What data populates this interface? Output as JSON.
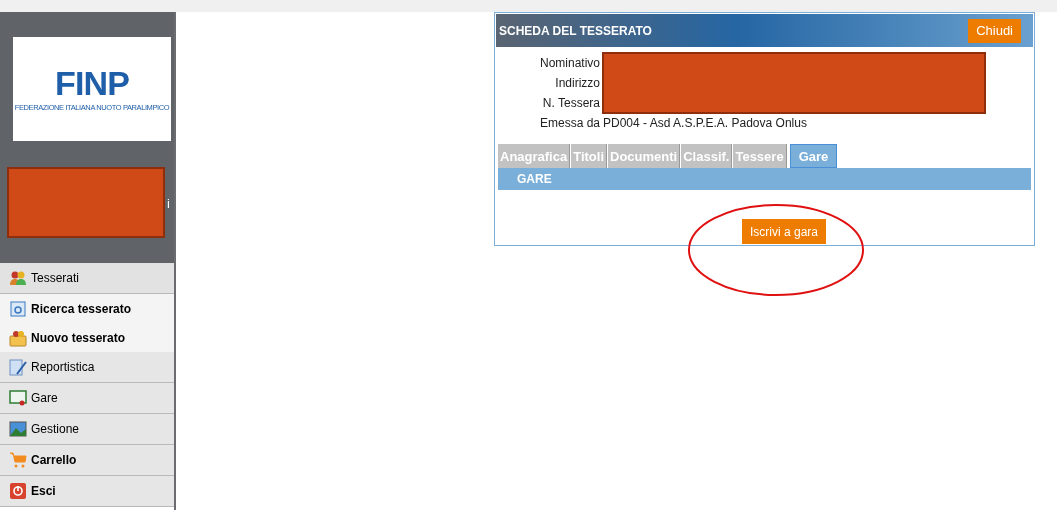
{
  "logo": {
    "mark": "FINP",
    "subtitle": "FEDERAZIONE ITALIANA NUOTO PARALIMPICO"
  },
  "sidebar": {
    "user_fragment": "i",
    "items": [
      {
        "label": "Tesserati",
        "kind": "section",
        "expanded": true,
        "children": [
          {
            "label": "Ricerca tesserato"
          },
          {
            "label": "Nuovo tesserato"
          }
        ]
      },
      {
        "label": "Reportistica",
        "kind": "section"
      },
      {
        "label": "Gare",
        "kind": "section"
      },
      {
        "label": "Gestione",
        "kind": "section"
      },
      {
        "label": "Carrello",
        "kind": "action"
      },
      {
        "label": "Esci",
        "kind": "action"
      }
    ]
  },
  "card": {
    "title": "SCHEDA DEL TESSERATO",
    "close_button": "Chiudi",
    "fields": [
      {
        "label": "Nominativo"
      },
      {
        "label": "Indirizzo"
      },
      {
        "label": "N. Tessera"
      },
      {
        "label": "Emessa da",
        "value": "PD004 - Asd A.S.P.E.A. Padova Onlus"
      }
    ],
    "tabs": [
      {
        "label": "Anagrafica",
        "selected": false
      },
      {
        "label": "Titoli",
        "selected": false
      },
      {
        "label": "Documenti",
        "selected": false
      },
      {
        "label": "Classif.",
        "selected": false
      },
      {
        "label": "Tessere",
        "selected": false
      },
      {
        "label": "Gare",
        "selected": true
      }
    ],
    "section_title": "GARE",
    "action_button": "Iscrivi a gara"
  }
}
